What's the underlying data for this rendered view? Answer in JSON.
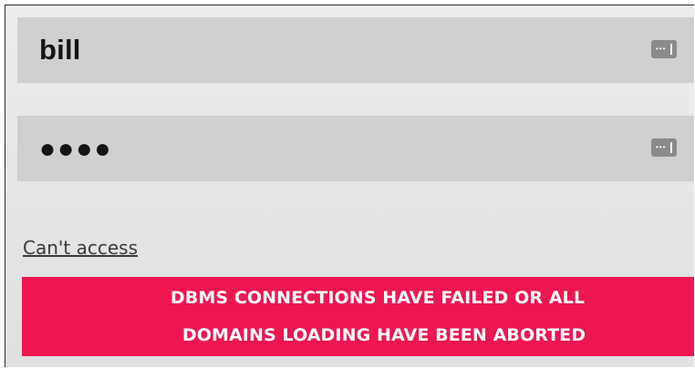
{
  "login": {
    "username_value": "bill",
    "password_mask": "●●●●",
    "username_icon": "password-manager-key-icon",
    "password_icon": "password-manager-key-icon",
    "cant_access_label": "Can't access"
  },
  "error": {
    "line1": "DBMS CONNECTIONS HAVE FAILED OR ALL",
    "line2": "DOMAINS LOADING HAVE BEEN ABORTED"
  },
  "colors": {
    "error_background": "#ee1651",
    "field_background": "#d0d0d0",
    "page_background": "#e4e5e7"
  }
}
